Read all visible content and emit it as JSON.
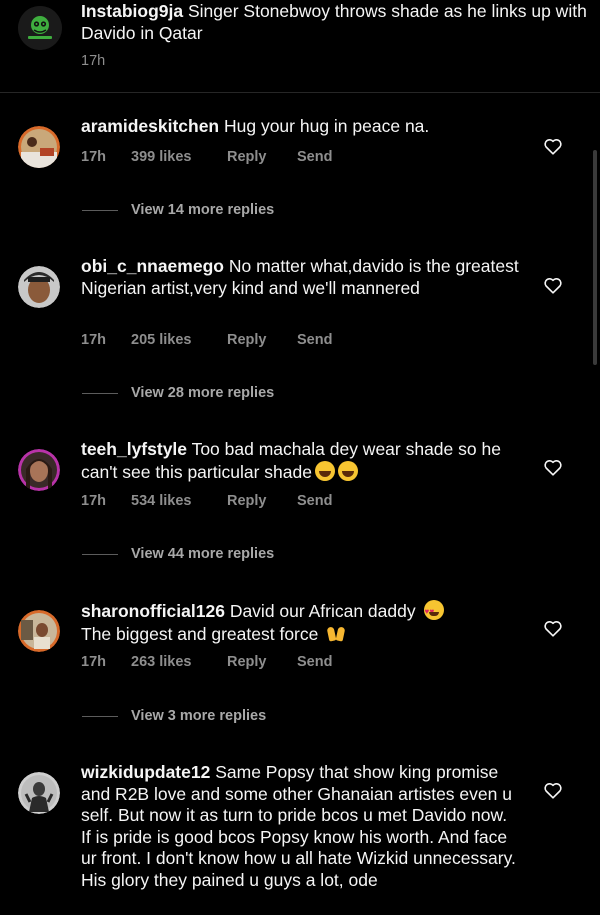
{
  "caption": {
    "avatar": "instabiog9ja-logo",
    "username": "Instabiog9ja",
    "text": " Singer Stonebwoy throws shade as he links up with Davido in Qatar",
    "time": "17h"
  },
  "comments": [
    {
      "username": "aramideskitchen",
      "text": " Hug your hug in peace na.",
      "time": "17h",
      "likes": "399 likes",
      "reply": "Reply",
      "send": "Send",
      "view_replies": "View 14 more replies"
    },
    {
      "username": "obi_c_nnaemego",
      "text": " No matter what,davido is the greatest Nigerian artist,very kind and we'll mannered",
      "time": "17h",
      "likes": "205 likes",
      "reply": "Reply",
      "send": "Send",
      "view_replies": "View 28 more replies"
    },
    {
      "username": "teeh_lyfstyle",
      "text": " Too bad machala dey wear shade so he can't see this particular shade",
      "time": "17h",
      "likes": "534 likes",
      "reply": "Reply",
      "send": "Send",
      "view_replies": "View 44 more replies"
    },
    {
      "username": "sharonofficial126",
      "text": " David our African daddy",
      "text2": "The biggest and greatest force",
      "time": "17h",
      "likes": "263 likes",
      "reply": "Reply",
      "send": "Send",
      "view_replies": "View 3 more replies"
    },
    {
      "username": "wizkidupdate12",
      "text": " Same Popsy that show king promise and R2B love and some other Ghanaian artistes even u self. But now it as turn to pride bcos u met Davido now. If is pride is good bcos Popsy know his worth. And face ur front. I don't know how u all hate Wizkid unnecessary. His glory they pained u guys a lot, ode"
    }
  ]
}
